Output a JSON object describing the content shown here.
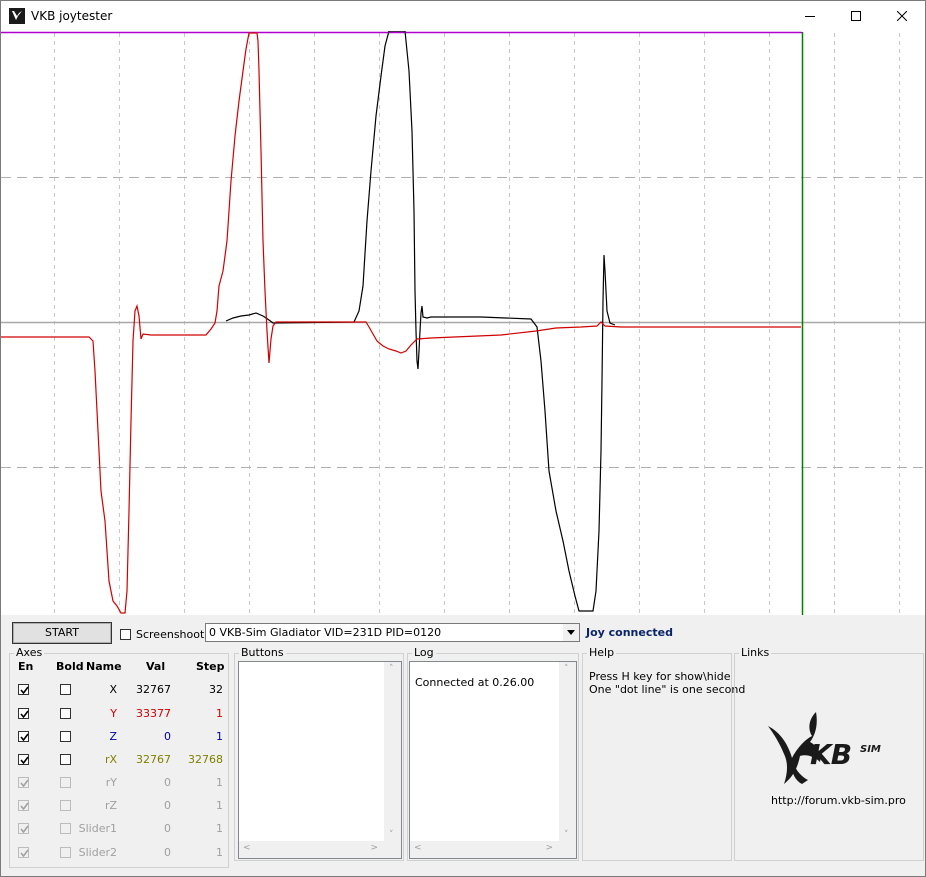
{
  "window": {
    "title": "VKB joytester",
    "minimize_icon": "minimize-icon",
    "maximize_icon": "maximize-icon",
    "close_icon": "close-icon"
  },
  "plot": {
    "colors": {
      "border_top": "#b000d0",
      "border_right": "#008000",
      "center_line": "#a0a0a0",
      "dashed": "#a0a0a0",
      "dotted": "#c8c8c8",
      "series_red": "#d00000",
      "series_black": "#000000"
    }
  },
  "toolbar": {
    "start_label": "START",
    "screenshoot_label": "Screenshoot",
    "screenshoot_checked": false,
    "device_selected": "0  VKB-Sim Gladiator  VID=231D PID=0120",
    "status_text": "Joy connected"
  },
  "axes": {
    "title": "Axes",
    "headers": {
      "en": "En",
      "bold": "Bold",
      "name": "Name",
      "val": "Val",
      "step": "Step"
    },
    "rows": [
      {
        "name": "X",
        "val": "32767",
        "step": "32",
        "color": "#000000",
        "enabled": true,
        "disabled_ui": false
      },
      {
        "name": "Y",
        "val": "33377",
        "step": "1",
        "color": "#d00000",
        "enabled": true,
        "disabled_ui": false
      },
      {
        "name": "Z",
        "val": "0",
        "step": "1",
        "color": "#0000a0",
        "enabled": true,
        "disabled_ui": false
      },
      {
        "name": "rX",
        "val": "32767",
        "step": "32768",
        "color": "#808000",
        "enabled": true,
        "disabled_ui": false
      },
      {
        "name": "rY",
        "val": "0",
        "step": "1",
        "color": "#a0a0a0",
        "enabled": true,
        "disabled_ui": true
      },
      {
        "name": "rZ",
        "val": "0",
        "step": "1",
        "color": "#a0a0a0",
        "enabled": true,
        "disabled_ui": true
      },
      {
        "name": "Slider1",
        "val": "0",
        "step": "1",
        "color": "#a0a0a0",
        "enabled": true,
        "disabled_ui": true
      },
      {
        "name": "Slider2",
        "val": "0",
        "step": "1",
        "color": "#a0a0a0",
        "enabled": true,
        "disabled_ui": true
      }
    ]
  },
  "buttons_group": {
    "title": "Buttons"
  },
  "log": {
    "title": "Log",
    "lines": [
      "Connected at 0.26.00"
    ]
  },
  "help": {
    "title": "Help",
    "line1": "Press H key for show\\hide",
    "line2": "One \"dot line\" is one second"
  },
  "links": {
    "title": "Links",
    "logo_text": "KB",
    "logo_sup": "SIM",
    "url": "http://forum.vkb-sim.pro"
  }
}
